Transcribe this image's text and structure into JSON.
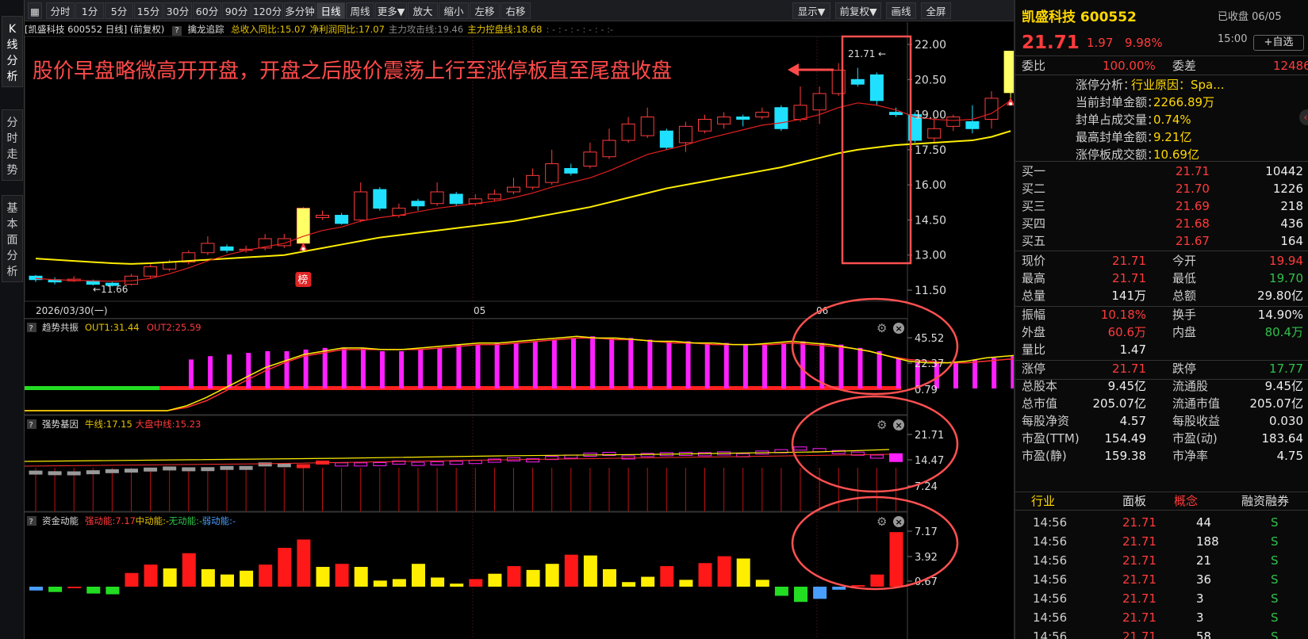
{
  "left_tabs": [
    {
      "label": "K线分析",
      "chars": [
        "K",
        "线",
        "分",
        "析"
      ]
    },
    {
      "label": "分时走势",
      "chars": [
        "分",
        "时",
        "走",
        "势"
      ]
    },
    {
      "label": "基本面分析",
      "chars": [
        "基",
        "本",
        "面",
        "分",
        "析"
      ]
    }
  ],
  "toolbar": {
    "left": [
      "分时",
      "1分",
      "5分",
      "15分",
      "30分",
      "60分",
      "90分",
      "120分",
      "多分钟",
      "日线",
      "周线",
      "更多▼",
      "放大",
      "缩小",
      "左移",
      "右移"
    ],
    "active": "日线",
    "right": [
      "显示▼",
      "前复权▼",
      "画线",
      "全屏"
    ]
  },
  "chart_header": {
    "stock": "[凯盛科技 600552 日线]",
    "adj": "(前复权)",
    "help": "?",
    "indicator": "擒龙追踪",
    "items": [
      {
        "text": "总收入同比:15.07",
        "color": "#e6c300"
      },
      {
        "text": "净利润同比:17.07",
        "color": "#e6c300"
      },
      {
        "text": "主力攻击线:19.46",
        "color": "#8a8a8a"
      },
      {
        "text": "主力控盘线:18.68",
        "color": "#e6c300"
      },
      {
        "text": ": - : - : - : - : - :-",
        "color": "#666"
      }
    ]
  },
  "annotation": "股价早盘略微高开开盘，开盘之后股价震荡上行至涨停板直至尾盘收盘",
  "main_chart": {
    "yticks": [
      "22.00",
      "20.50",
      "19.00",
      "17.50",
      "16.00",
      "14.50",
      "13.00",
      "11.50"
    ],
    "high_label": "21.71",
    "low_label": "11.66",
    "bang_label": "榜",
    "date_labels": [
      "2026/03/30(一)",
      "05",
      "06"
    ]
  },
  "panel1": {
    "help": "?",
    "title": "趋势共振",
    "items": [
      {
        "text": "OUT1:31.44",
        "color": "#e6c300"
      },
      {
        "text": "OUT2:25.59",
        "color": "#ff3b3b"
      }
    ],
    "yticks": [
      "45.52",
      "22.37",
      "0.79"
    ]
  },
  "panel2": {
    "help": "?",
    "title": "强势基因",
    "items": [
      {
        "text": "牛线:17.15",
        "color": "#e6c300"
      },
      {
        "text": "大盘中线:15.23",
        "color": "#ff3b3b"
      }
    ],
    "yticks": [
      "21.71",
      "14.47",
      "7.24"
    ]
  },
  "panel3": {
    "help": "?",
    "title": "资金动能",
    "items": [
      {
        "text": "强动能:7.17",
        "color": "#ff3b3b"
      },
      {
        "text": "中动能:-",
        "color": "#e6c300"
      },
      {
        "text": "无动能:-",
        "color": "#2ec24a"
      },
      {
        "text": "弱动能:-",
        "color": "#4a9eff"
      }
    ],
    "yticks": [
      "7.17",
      "3.92",
      "0.67"
    ]
  },
  "quote": {
    "name": "凯盛科技 600552",
    "status": "已收盘 06/05 15:00",
    "price": "21.71",
    "change": "1.97",
    "pct": "9.98%",
    "add_button": "+自选",
    "weibi_label": "委比",
    "weibi": "100.00%",
    "weicha_label": "委差",
    "weicha": "12486",
    "limit": [
      {
        "label": "涨停分析：",
        "value": "行业原因：Spa..."
      },
      {
        "label": "当前封单金额：",
        "value": "2266.89万"
      },
      {
        "label": "封单占成交量：",
        "value": "0.74%"
      },
      {
        "label": "最高封单金额：",
        "value": "9.21亿"
      },
      {
        "label": "涨停板成交额：",
        "value": "10.69亿"
      }
    ],
    "bids": [
      {
        "label": "买一",
        "price": "21.71",
        "vol": "10442"
      },
      {
        "label": "买二",
        "price": "21.70",
        "vol": "1226"
      },
      {
        "label": "买三",
        "price": "21.69",
        "vol": "218"
      },
      {
        "label": "买四",
        "price": "21.68",
        "vol": "436"
      },
      {
        "label": "买五",
        "price": "21.67",
        "vol": "164"
      }
    ],
    "stats1": [
      {
        "l1": "现价",
        "v1": "21.71",
        "c1": "red",
        "l2": "今开",
        "v2": "19.94",
        "c2": "red"
      },
      {
        "l1": "最高",
        "v1": "21.71",
        "c1": "red",
        "l2": "最低",
        "v2": "19.70",
        "c2": "green"
      },
      {
        "l1": "总量",
        "v1": "141万",
        "c1": "white",
        "l2": "总额",
        "v2": "29.80亿",
        "c2": "white"
      }
    ],
    "stats2": [
      {
        "l1": "振幅",
        "v1": "10.18%",
        "c1": "red",
        "l2": "换手",
        "v2": "14.90%",
        "c2": "white"
      },
      {
        "l1": "外盘",
        "v1": "60.6万",
        "c1": "red",
        "l2": "内盘",
        "v2": "80.4万",
        "c2": "green"
      },
      {
        "l1": "量比",
        "v1": "1.47",
        "c1": "white",
        "l2": "",
        "v2": "",
        "c2": "white"
      }
    ],
    "stats3": [
      {
        "l1": "涨停",
        "v1": "21.71",
        "c1": "red",
        "l2": "跌停",
        "v2": "17.77",
        "c2": "green"
      }
    ],
    "stats4": [
      {
        "l1": "总股本",
        "v1": "9.45亿",
        "c1": "white",
        "l2": "流通股",
        "v2": "9.45亿",
        "c2": "white"
      },
      {
        "l1": "总市值",
        "v1": "205.07亿",
        "c1": "white",
        "l2": "流通市值",
        "v2": "205.07亿",
        "c2": "white"
      },
      {
        "l1": "每股净资",
        "v1": "4.57",
        "c1": "white",
        "l2": "每股收益",
        "v2": "0.030",
        "c2": "white"
      },
      {
        "l1": "市盈(TTM)",
        "v1": "154.49",
        "c1": "white",
        "l2": "市盈(动)",
        "v2": "183.64",
        "c2": "white"
      },
      {
        "l1": "市盈(静)",
        "v1": "159.38",
        "c1": "white",
        "l2": "市净率",
        "v2": "4.75",
        "c2": "white"
      }
    ],
    "tabs": [
      "行业",
      "面板",
      "概念",
      "融资融券"
    ],
    "active_tab": "概念",
    "ticks": [
      {
        "time": "14:56",
        "price": "21.71",
        "vol": "44",
        "side": "S"
      },
      {
        "time": "14:56",
        "price": "21.71",
        "vol": "188",
        "side": "S"
      },
      {
        "time": "14:56",
        "price": "21.71",
        "vol": "21",
        "side": "S"
      },
      {
        "time": "14:56",
        "price": "21.71",
        "vol": "36",
        "side": "S"
      },
      {
        "time": "14:56",
        "price": "21.71",
        "vol": "3",
        "side": "S"
      },
      {
        "time": "14:56",
        "price": "21.71",
        "vol": "3",
        "side": "S"
      },
      {
        "time": "14:56",
        "price": "21.71",
        "vol": "58",
        "side": "S"
      }
    ]
  },
  "chart_data": [
    {
      "type": "candlestick",
      "ylim": [
        11.5,
        22.0
      ],
      "x_axis": {
        "dates_printed": [
          "2026/03/30(一)",
          "05",
          "06"
        ]
      },
      "candles": [
        [
          12.1,
          11.95,
          12.15,
          11.85
        ],
        [
          11.95,
          11.85,
          12.05,
          11.75
        ],
        [
          11.9,
          11.97,
          12.1,
          11.85
        ],
        [
          11.9,
          11.75,
          11.95,
          11.7
        ],
        [
          11.8,
          11.7,
          11.85,
          11.66
        ],
        [
          11.75,
          12.1,
          12.2,
          11.7
        ],
        [
          12.1,
          12.5,
          12.6,
          12.0
        ],
        [
          12.4,
          12.7,
          12.8,
          12.3
        ],
        [
          12.7,
          13.1,
          13.2,
          12.6
        ],
        [
          13.1,
          13.5,
          13.8,
          13.0
        ],
        [
          13.35,
          13.2,
          13.45,
          13.1
        ],
        [
          13.2,
          13.25,
          13.4,
          13.1
        ],
        [
          13.3,
          13.7,
          13.9,
          13.2
        ],
        [
          13.4,
          13.7,
          13.9,
          13.3
        ],
        [
          13.5,
          15.0,
          15.05,
          13.45
        ],
        [
          14.6,
          14.7,
          14.9,
          14.5
        ],
        [
          14.7,
          14.35,
          14.8,
          14.3
        ],
        [
          14.5,
          15.7,
          16.1,
          14.4
        ],
        [
          15.8,
          15.0,
          15.9,
          14.9
        ],
        [
          14.7,
          15.0,
          15.2,
          14.6
        ],
        [
          15.3,
          15.1,
          15.4,
          14.9
        ],
        [
          15.2,
          15.7,
          16.1,
          15.1
        ],
        [
          15.6,
          15.2,
          15.7,
          15.1
        ],
        [
          15.2,
          15.4,
          15.6,
          15.1
        ],
        [
          15.4,
          15.6,
          15.8,
          15.3
        ],
        [
          15.7,
          15.9,
          16.3,
          15.6
        ],
        [
          15.9,
          16.4,
          16.7,
          15.8
        ],
        [
          16.1,
          16.9,
          17.5,
          16.0
        ],
        [
          16.7,
          16.5,
          16.9,
          16.4
        ],
        [
          16.8,
          17.4,
          17.8,
          16.7
        ],
        [
          17.2,
          17.9,
          18.4,
          17.1
        ],
        [
          17.9,
          18.6,
          18.9,
          17.8
        ],
        [
          18.1,
          18.9,
          19.3,
          18.0
        ],
        [
          18.3,
          17.6,
          18.4,
          17.5
        ],
        [
          17.8,
          18.5,
          18.7,
          17.4
        ],
        [
          18.3,
          18.8,
          19.0,
          18.2
        ],
        [
          18.6,
          18.9,
          19.1,
          18.4
        ],
        [
          18.9,
          18.8,
          19.0,
          18.5
        ],
        [
          18.9,
          19.1,
          19.3,
          18.8
        ],
        [
          19.3,
          18.4,
          19.4,
          18.3
        ],
        [
          18.8,
          19.4,
          20.2,
          18.7
        ],
        [
          19.2,
          19.9,
          20.2,
          18.6
        ],
        [
          19.9,
          20.9,
          21.2,
          19.8
        ],
        [
          20.5,
          20.3,
          21.0,
          20.2
        ],
        [
          20.7,
          19.6,
          20.8,
          19.4
        ],
        [
          19.1,
          19.0,
          19.3,
          18.9
        ],
        [
          19.0,
          17.9,
          19.1,
          17.8
        ],
        [
          18.0,
          18.4,
          18.9,
          17.8
        ],
        [
          18.5,
          18.9,
          19.0,
          18.3
        ],
        [
          18.7,
          18.4,
          19.4,
          18.2
        ],
        [
          18.8,
          19.7,
          20.0,
          18.4
        ],
        [
          19.94,
          21.71,
          21.71,
          19.7
        ]
      ],
      "ma_short": [
        12.0,
        11.95,
        11.92,
        11.9,
        11.88,
        11.9,
        12.0,
        12.2,
        12.45,
        12.75,
        13.0,
        13.2,
        13.35,
        13.5,
        13.8,
        14.05,
        14.2,
        14.45,
        14.6,
        14.7,
        14.85,
        15.0,
        15.1,
        15.2,
        15.3,
        15.45,
        15.65,
        15.9,
        16.1,
        16.3,
        16.6,
        16.95,
        17.3,
        17.5,
        17.7,
        17.95,
        18.15,
        18.35,
        18.55,
        18.65,
        18.8,
        19.0,
        19.3,
        19.5,
        19.4,
        19.2,
        18.9,
        18.8,
        18.75,
        18.8,
        19.05,
        19.6
      ],
      "ma_long": [
        12.85,
        12.8,
        12.75,
        12.7,
        12.65,
        12.62,
        12.65,
        12.7,
        12.75,
        12.8,
        12.85,
        12.9,
        12.95,
        13.0,
        13.15,
        13.3,
        13.45,
        13.6,
        13.75,
        13.85,
        13.95,
        14.05,
        14.15,
        14.25,
        14.35,
        14.45,
        14.6,
        14.75,
        14.9,
        15.05,
        15.25,
        15.45,
        15.65,
        15.85,
        16.0,
        16.15,
        16.3,
        16.45,
        16.6,
        16.75,
        16.95,
        17.15,
        17.35,
        17.5,
        17.6,
        17.7,
        17.75,
        17.8,
        17.85,
        17.9,
        18.05,
        18.3
      ]
    },
    {
      "type": "bar",
      "title": "趋势共振",
      "ylim": [
        0,
        48
      ],
      "values": [
        31,
        33,
        34,
        35,
        36,
        36,
        37,
        38,
        38,
        38,
        36,
        36,
        37,
        38,
        40,
        40,
        41,
        41,
        42,
        43,
        44,
        45,
        44,
        44,
        43,
        42,
        42,
        41,
        41,
        40,
        40,
        41,
        42,
        41,
        40,
        38,
        36,
        32,
        30,
        29,
        29,
        31,
        32,
        33,
        34
      ],
      "out1": [
        0,
        3,
        8,
        14,
        20,
        26,
        30,
        34,
        36,
        38,
        38,
        37,
        37,
        38,
        39,
        40,
        41,
        41,
        42,
        43,
        44,
        45,
        44,
        44,
        43,
        42,
        42,
        41,
        41,
        40,
        40,
        41,
        42,
        41,
        40,
        38,
        36,
        33,
        30,
        29,
        29,
        30,
        32,
        33,
        34
      ],
      "out2": [
        0,
        2,
        6,
        12,
        18,
        24,
        29,
        33,
        35,
        37,
        37,
        37,
        37,
        37,
        38,
        39,
        40,
        40,
        41,
        42,
        43,
        44,
        44,
        43,
        43,
        42,
        41,
        41,
        40,
        40,
        40,
        40,
        41,
        40,
        39,
        38,
        36,
        33,
        31,
        30,
        29,
        29,
        30,
        31,
        32
      ]
    },
    {
      "type": "bar",
      "title": "强势基因",
      "ylim": [
        0,
        24
      ]
    },
    {
      "type": "bar",
      "title": "资金动能",
      "ylim": [
        -2,
        7.8
      ],
      "values": [
        -0.5,
        -0.7,
        -0.2,
        -0.9,
        -1.0,
        1.8,
        2.9,
        2.4,
        4.4,
        2.3,
        1.6,
        2.1,
        2.9,
        5.1,
        6.2,
        2.6,
        3.0,
        2.6,
        0.8,
        1.0,
        3.0,
        1.2,
        0.4,
        1.0,
        1.7,
        2.7,
        2.2,
        3.0,
        4.2,
        4.1,
        2.3,
        0.6,
        1.3,
        2.7,
        0.9,
        3.1,
        4.0,
        3.7,
        0.9,
        -1.2,
        -2.0,
        -1.6,
        -0.4,
        0.2,
        1.6,
        7.17
      ],
      "colors": [
        "blue",
        "green",
        "red",
        "green",
        "green",
        "red",
        "red",
        "yellow",
        "red",
        "yellow",
        "yellow",
        "yellow",
        "red",
        "red",
        "red",
        "yellow",
        "red",
        "yellow",
        "yellow",
        "yellow",
        "yellow",
        "yellow",
        "yellow",
        "red",
        "yellow",
        "red",
        "yellow",
        "yellow",
        "red",
        "yellow",
        "yellow",
        "yellow",
        "yellow",
        "red",
        "yellow",
        "red",
        "red",
        "yellow",
        "yellow",
        "green",
        "green",
        "blue",
        "blue",
        "red",
        "red",
        "red"
      ]
    }
  ]
}
